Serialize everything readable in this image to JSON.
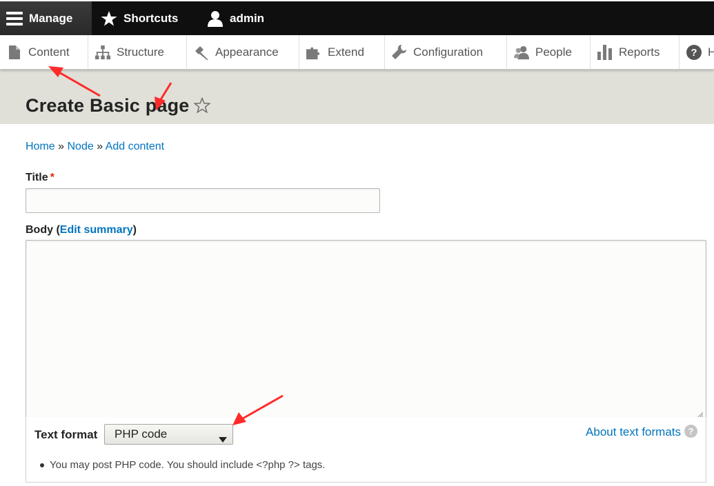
{
  "toolbar": {
    "manage": "Manage",
    "shortcuts": "Shortcuts",
    "user": "admin"
  },
  "tray": {
    "items": [
      {
        "label": "Content",
        "icon": "document-icon"
      },
      {
        "label": "Structure",
        "icon": "sitemap-icon"
      },
      {
        "label": "Appearance",
        "icon": "paintbrush-icon"
      },
      {
        "label": "Extend",
        "icon": "puzzle-icon"
      },
      {
        "label": "Configuration",
        "icon": "wrench-icon"
      },
      {
        "label": "People",
        "icon": "people-icon"
      },
      {
        "label": "Reports",
        "icon": "bar-chart-icon"
      },
      {
        "label": "H",
        "icon": "help-icon"
      }
    ]
  },
  "page": {
    "title": "Create Basic page"
  },
  "breadcrumb": {
    "items": [
      "Home",
      "Node",
      "Add content"
    ],
    "separator": "»"
  },
  "form": {
    "title_label": "Title",
    "required_mark": "*",
    "title_value": "",
    "body_label": "Body (",
    "edit_summary": "Edit summary",
    "body_label_end": ")",
    "body_value": "",
    "text_format_label": "Text format",
    "text_format_value": "PHP code",
    "about_text_formats": "About text formats",
    "tip": "You may post PHP code. You should include <?php ?> tags."
  },
  "colors": {
    "toolbar_bg": "#0f0f0f",
    "header_band": "#e0e0d8",
    "link": "#0074bd",
    "required": "#e32700",
    "annotation": "#ff2a2a"
  }
}
